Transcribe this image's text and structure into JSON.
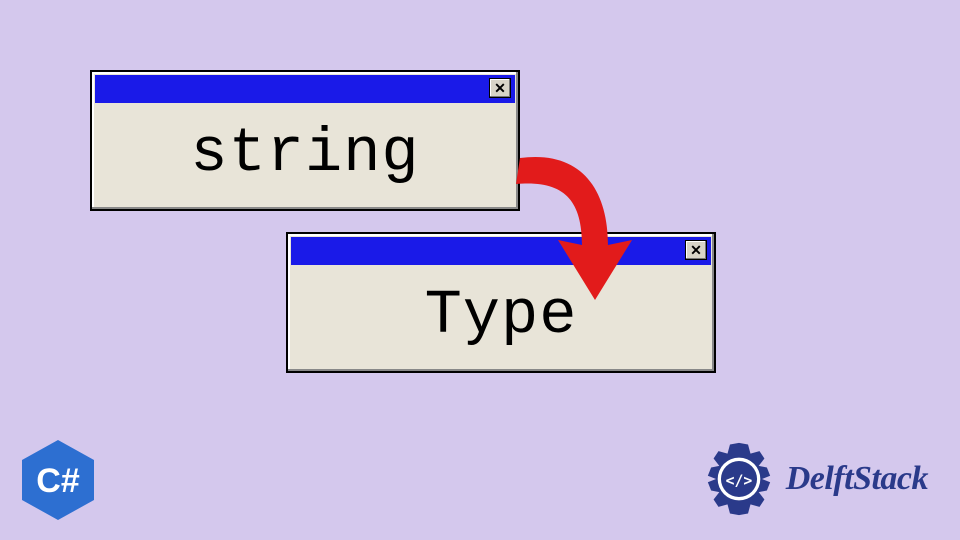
{
  "windows": {
    "first": {
      "content": "string",
      "close_glyph": "✕"
    },
    "second": {
      "content": "Type",
      "close_glyph": "✕"
    }
  },
  "badges": {
    "csharp_label": "C#",
    "brand_name": "DelftStack",
    "brand_code": "</>"
  },
  "colors": {
    "background": "#d4c8ed",
    "titlebar": "#1a1ae8",
    "window_bg": "#e8e4d8",
    "arrow": "#e21b1b",
    "brand": "#2a3a8a"
  }
}
